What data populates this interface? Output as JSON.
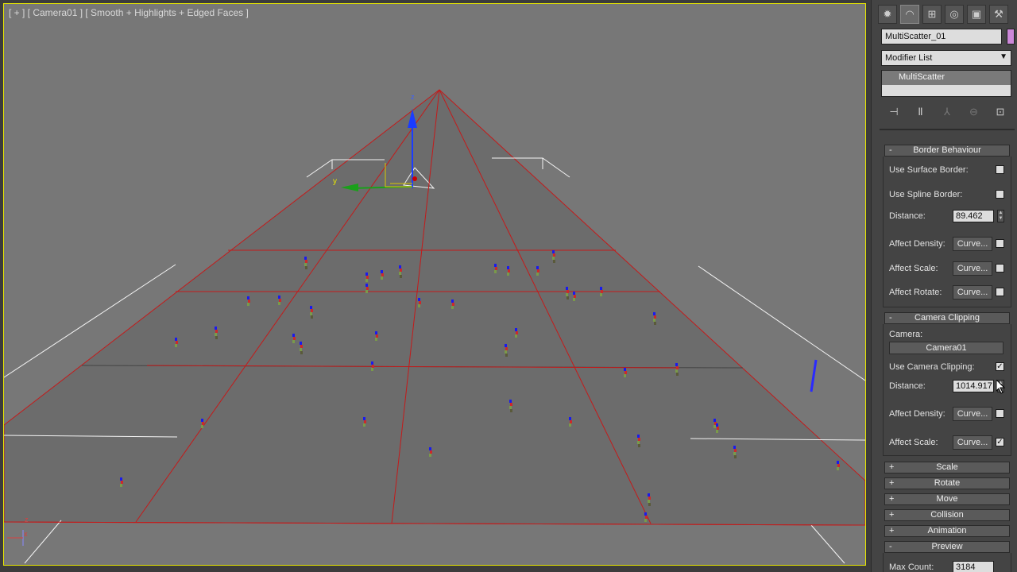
{
  "viewport": {
    "label": "[ + ] [ Camera01 ] [ Smooth + Highlights + Edged Faces ]",
    "axis_labels": {
      "z": "z",
      "y": "y",
      "x": "x"
    }
  },
  "command_panel": {
    "tabs": [
      {
        "name": "create",
        "icon": "sun-icon",
        "glyph": "✹"
      },
      {
        "name": "modify",
        "icon": "modify-icon",
        "glyph": "◠"
      },
      {
        "name": "hierarchy",
        "icon": "hierarchy-icon",
        "glyph": "⊞"
      },
      {
        "name": "motion",
        "icon": "motion-icon",
        "glyph": "◎"
      },
      {
        "name": "display",
        "icon": "display-icon",
        "glyph": "▣"
      },
      {
        "name": "utilities",
        "icon": "hammer-icon",
        "glyph": "⚒"
      }
    ],
    "object_name": "MultiScatter_01",
    "object_color": "#cc88d8",
    "modifier_list_label": "Modifier List",
    "stack_item": "MultiScatter",
    "stack_tools": [
      "⊣",
      "Ⅱ",
      "⅄",
      "⊖",
      "⊡"
    ]
  },
  "border_behaviour": {
    "title": "Border Behaviour",
    "use_surface_border_label": "Use Surface Border:",
    "use_surface_border_checked": false,
    "use_spline_border_label": "Use Spline Border:",
    "use_spline_border_checked": false,
    "distance_label": "Distance:",
    "distance_value": "89.462",
    "affect_density_label": "Affect Density:",
    "affect_density_checked": false,
    "affect_scale_label": "Affect Scale:",
    "affect_scale_checked": false,
    "affect_rotate_label": "Affect Rotate:",
    "affect_rotate_checked": false,
    "curve_label": "Curve..."
  },
  "camera_clipping": {
    "title": "Camera Clipping",
    "camera_label": "Camera:",
    "camera_value": "Camera01",
    "use_camera_clipping_label": "Use Camera Clipping:",
    "use_camera_clipping_checked": true,
    "distance_label": "Distance:",
    "distance_value": "1014.917",
    "affect_density_label": "Affect Density:",
    "affect_density_checked": false,
    "affect_scale_label": "Affect Scale:",
    "affect_scale_checked": true,
    "curve_label": "Curve..."
  },
  "collapsed_rollouts": [
    {
      "title": "Scale",
      "sign": "+"
    },
    {
      "title": "Rotate",
      "sign": "+"
    },
    {
      "title": "Move",
      "sign": "+"
    },
    {
      "title": "Collision",
      "sign": "+"
    },
    {
      "title": "Animation",
      "sign": "+"
    },
    {
      "title": "Preview",
      "sign": "-"
    }
  ],
  "preview": {
    "max_count_label": "Max Count:",
    "max_count_value": "3184"
  }
}
